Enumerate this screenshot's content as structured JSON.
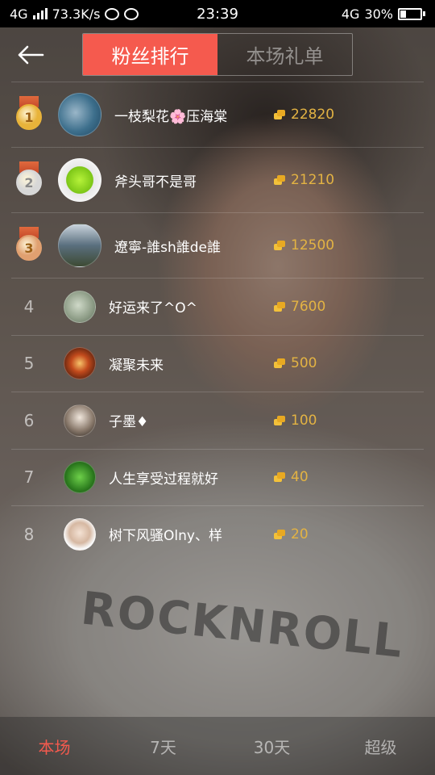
{
  "status_bar": {
    "network": "4G",
    "speed": "73.3K/s",
    "time": "23:39",
    "network_right": "4G",
    "battery": "30%"
  },
  "header": {
    "tabs": [
      {
        "label": "粉丝排行",
        "active": true
      },
      {
        "label": "本场礼单",
        "active": false
      }
    ]
  },
  "ranking": [
    {
      "rank": "1",
      "medal": "gold",
      "name": "一枝梨花🌸压海棠",
      "score": "22820"
    },
    {
      "rank": "2",
      "medal": "silver",
      "name": "斧头哥不是哥",
      "score": "21210"
    },
    {
      "rank": "3",
      "medal": "bronze",
      "name": "遼寧-誰sh誰de誰",
      "score": "12500"
    },
    {
      "rank": "4",
      "name": "好运来了^O^",
      "score": "7600"
    },
    {
      "rank": "5",
      "name": "凝聚未来",
      "score": "500"
    },
    {
      "rank": "6",
      "name": "子墨♦",
      "score": "100"
    },
    {
      "rank": "7",
      "name": "人生享受过程就好",
      "score": "40"
    },
    {
      "rank": "8",
      "name": "树下风骚Olny、样",
      "score": "20"
    }
  ],
  "bottom_tabs": [
    {
      "label": "本场",
      "active": true
    },
    {
      "label": "7天",
      "active": false
    },
    {
      "label": "30天",
      "active": false
    },
    {
      "label": "超级",
      "active": false
    }
  ],
  "colors": {
    "accent": "#f55a4e",
    "score": "#e3b343",
    "gold": "#e8b33a",
    "silver": "#d7d7d7",
    "bronze": "#e0a070"
  }
}
